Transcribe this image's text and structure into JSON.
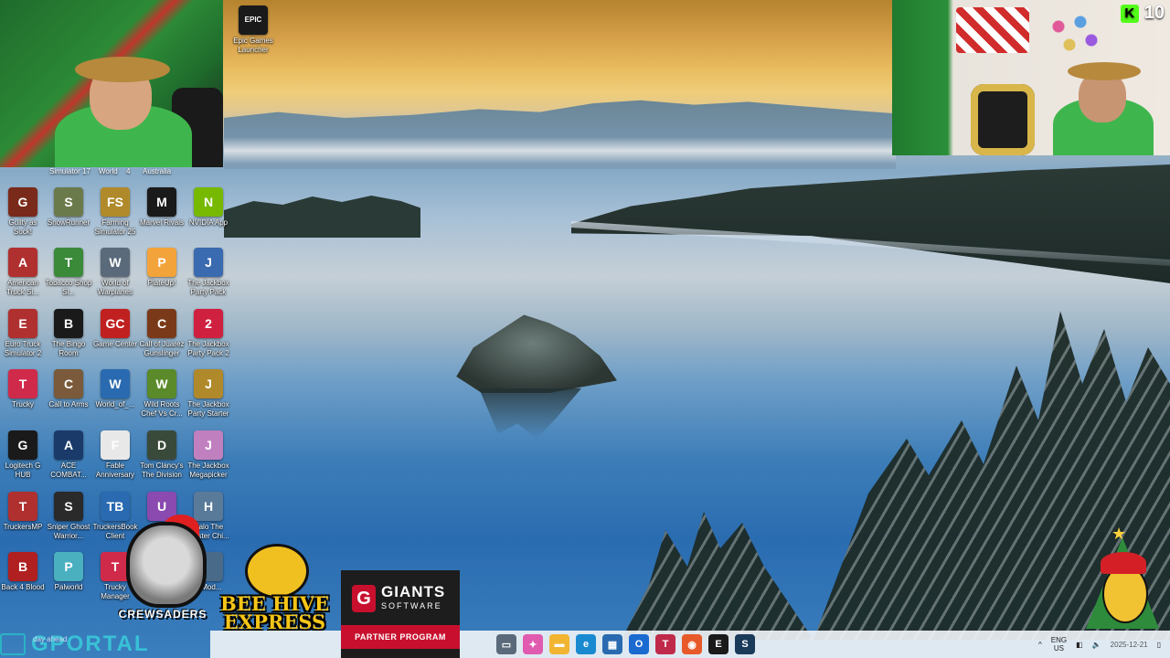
{
  "webcam_right": {
    "viewer_count": "10"
  },
  "desktop": {
    "top_right_icon": {
      "label": "Epic Games Launcher",
      "glyph": "EPIC\nGAMES"
    },
    "partial_labels": [
      "Simulator 17",
      "World",
      "4",
      "Australia"
    ],
    "rows": [
      [
        {
          "label": "Guilty as Sock!",
          "color": "#7a2a1a",
          "glyph": "G"
        },
        {
          "label": "SnowRunner",
          "color": "#6b7a4a",
          "glyph": "S"
        },
        {
          "label": "Farming Simulator 25",
          "color": "#b08a2a",
          "glyph": "FS"
        },
        {
          "label": "Marvel Rivals",
          "color": "#1a1a1a",
          "glyph": "M"
        },
        {
          "label": "NVIDIA App",
          "color": "#76b900",
          "glyph": "N"
        }
      ],
      [
        {
          "label": "American Truck Si...",
          "color": "#b03030",
          "glyph": "A"
        },
        {
          "label": "Tobacco Shop Si...",
          "color": "#3a8a3a",
          "glyph": "T"
        },
        {
          "label": "World of Warplanes",
          "color": "#5a6a7a",
          "glyph": "W"
        },
        {
          "label": "PlateUp!",
          "color": "#f2a33a",
          "glyph": "P"
        },
        {
          "label": "The Jackbox Party Pack",
          "color": "#3a6ab0",
          "glyph": "J"
        }
      ],
      [
        {
          "label": "Euro Truck Simulator 2",
          "color": "#b03030",
          "glyph": "E"
        },
        {
          "label": "The Bingo Room",
          "color": "#1a1a1a",
          "glyph": "B"
        },
        {
          "label": "Game Center",
          "color": "#c02020",
          "glyph": "GC"
        },
        {
          "label": "Call of Juarez Gunslinger",
          "color": "#7a3a1a",
          "glyph": "C"
        },
        {
          "label": "The Jackbox Party Pack 2",
          "color": "#d02040",
          "glyph": "2"
        }
      ],
      [
        {
          "label": "Trucky",
          "color": "#d02a4a",
          "glyph": "T"
        },
        {
          "label": "Call to Arms",
          "color": "#7a5a3a",
          "glyph": "C"
        },
        {
          "label": "World_of_...",
          "color": "#2a6ab0",
          "glyph": "W"
        },
        {
          "label": "Wild Roots Chef Vs Cr...",
          "color": "#5a8a2a",
          "glyph": "W"
        },
        {
          "label": "The Jackbox Party Starter",
          "color": "#b08a2a",
          "glyph": "J"
        }
      ],
      [
        {
          "label": "Logitech G HUB",
          "color": "#1a1a1a",
          "glyph": "G"
        },
        {
          "label": "ACE COMBAT...",
          "color": "#1a3a6a",
          "glyph": "A"
        },
        {
          "label": "Fable Anniversary",
          "color": "#e8e8e8",
          "glyph": "F"
        },
        {
          "label": "Tom Clancy's The Division",
          "color": "#3a4a3a",
          "glyph": "D"
        },
        {
          "label": "The Jackbox Megapicker",
          "color": "#c080c0",
          "glyph": "J"
        }
      ],
      [
        {
          "label": "TruckersMP",
          "color": "#b03030",
          "glyph": "T"
        },
        {
          "label": "Sniper Ghost Warrior...",
          "color": "#2a2a2a",
          "glyph": "S"
        },
        {
          "label": "TruckersBook Client",
          "color": "#2a6ab0",
          "glyph": "TB"
        },
        {
          "label": "",
          "color": "#8a4ab0",
          "glyph": "U"
        },
        {
          "label": "Halo The Master Chi...",
          "color": "#5a7a9a",
          "glyph": "H"
        }
      ],
      [
        {
          "label": "Back 4 Blood",
          "color": "#b02020",
          "glyph": "B"
        },
        {
          "label": "Palworld",
          "color": "#4ab0c0",
          "glyph": "P"
        },
        {
          "label": "Trucky Manager",
          "color": "#d02a4a",
          "glyph": "T"
        },
        {
          "label": "",
          "color": "#6a6a6a",
          "glyph": ""
        },
        {
          "label": "...Mod...",
          "color": "#4a6a8a",
          "glyph": ""
        }
      ]
    ]
  },
  "logos": {
    "crewsaders": "CREWSADERS",
    "beehive": "BEE HIVE EXPRESS",
    "giants_name": "GIANTS",
    "giants_sub": "SOFTWARE",
    "giants_program": "PARTNER PROGRAM",
    "gportal": "GPORTAL"
  },
  "taskbar": {
    "search_hint": "day ahead",
    "apps": [
      {
        "name": "task-view-icon",
        "color": "#5a6a7a",
        "glyph": "▭"
      },
      {
        "name": "copilot-icon",
        "color": "#e05ab0",
        "glyph": "✦"
      },
      {
        "name": "file-explorer-icon",
        "color": "#f2b531",
        "glyph": "▬"
      },
      {
        "name": "edge-icon",
        "color": "#1a8ad0",
        "glyph": "e"
      },
      {
        "name": "store-icon",
        "color": "#2a6ab0",
        "glyph": "▦"
      },
      {
        "name": "outlook-icon",
        "color": "#1a6ad0",
        "glyph": "O"
      },
      {
        "name": "trucky-icon",
        "color": "#c02a4a",
        "glyph": "T"
      },
      {
        "name": "browser-icon",
        "color": "#e85a2a",
        "glyph": "◉"
      },
      {
        "name": "epic-games-icon",
        "color": "#1a1a1a",
        "glyph": "E"
      },
      {
        "name": "steam-icon",
        "color": "#1a3a5a",
        "glyph": "S"
      }
    ],
    "tray": {
      "chevron": "^",
      "lang_top": "ENG",
      "lang_bottom": "US",
      "time": "",
      "date": "2025-12-21"
    }
  }
}
